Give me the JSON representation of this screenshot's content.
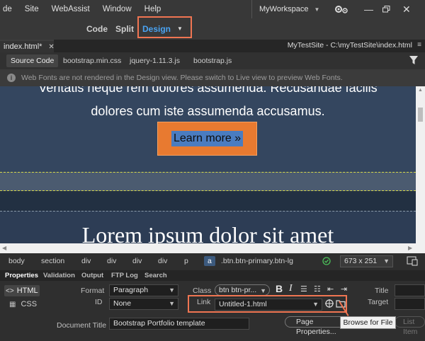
{
  "menubar": {
    "items": [
      "de",
      "Site",
      "WebAssist",
      "Window",
      "Help"
    ],
    "workspace": "MyWorkspace"
  },
  "viewbar": {
    "code": "Code",
    "split": "Split",
    "design": "Design"
  },
  "document": {
    "tab_label": "index.html*",
    "site_path": "MyTestSite - C:\\myTestSite\\index.html"
  },
  "related_files": [
    "Source Code",
    "bootstrap.min.css",
    "jquery-1.11.3.js",
    "bootstrap.js"
  ],
  "infobar": {
    "message": "Web Fonts are not rendered in the Design view. Please switch to Live view to preview Web Fonts."
  },
  "canvas": {
    "line1": "Veritatis neque rem dolores assumenda. Recusandae facilis",
    "line2": "dolores cum iste assumenda accusamus.",
    "button_text": "Learn more »",
    "heading": "Lorem ipsum dolor sit amet"
  },
  "tag_selector": {
    "tags": [
      "body",
      "section",
      "div",
      "div",
      "div",
      "div",
      "p",
      "a"
    ],
    "selector": ".btn.btn-primary.btn-lg",
    "dimensions": "673 x 251"
  },
  "panel_tabs": [
    "Properties",
    "Validation",
    "Output",
    "FTP Log",
    "Search"
  ],
  "properties": {
    "html_label": "HTML",
    "css_label": "CSS",
    "format_label": "Format",
    "format_value": "Paragraph",
    "id_label": "ID",
    "id_value": "None",
    "class_label": "Class",
    "class_value": "btn btn-pr...",
    "bold": "B",
    "italic": "I",
    "link_label": "Link",
    "link_value": "Untitled-1.html",
    "title_label": "Title",
    "target_label": "Target",
    "doc_title_label": "Document Title",
    "doc_title_value": "Bootstrap Portfolio template",
    "page_properties": "Page Properties...",
    "list_item": "List Item",
    "tooltip": "Browse for File"
  },
  "colors": {
    "highlight": "#f07552",
    "canvas_bg": "#34465f",
    "button_bg": "#e87a30",
    "selection": "#4a7cc0"
  }
}
